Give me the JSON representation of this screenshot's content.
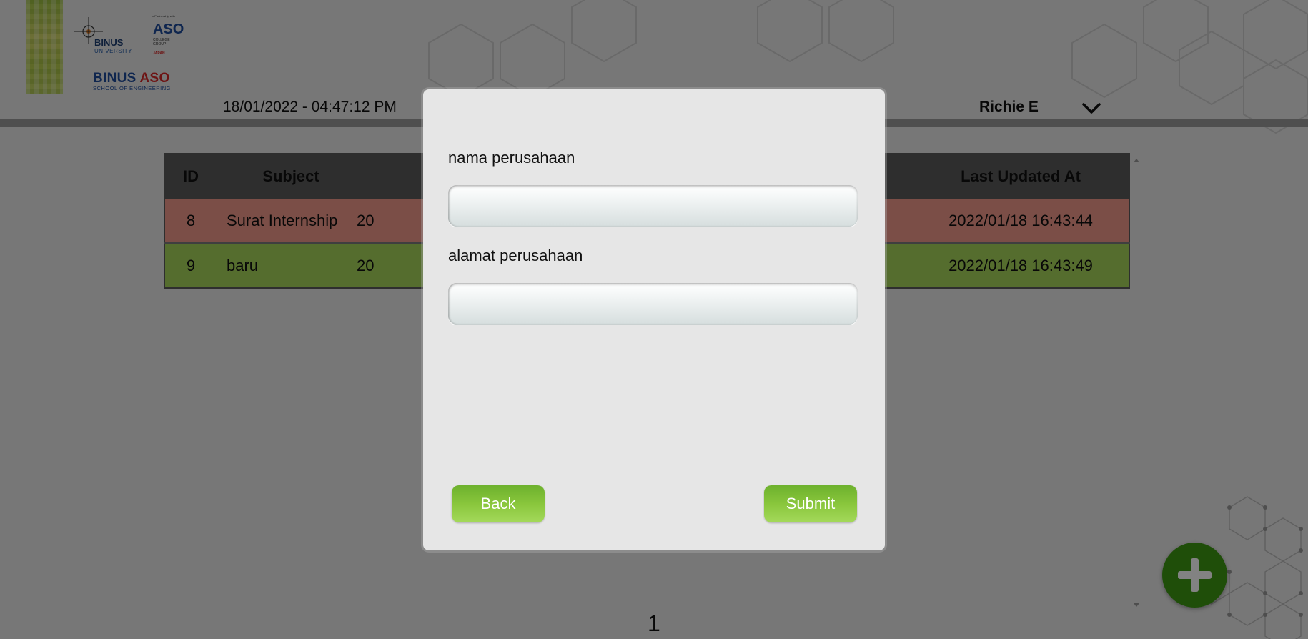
{
  "header": {
    "logos": {
      "binus": {
        "title": "BINUS",
        "subtitle": "UNIVERSITY"
      },
      "aso": {
        "tagline": "in Partnership with",
        "title": "ASO",
        "subtitle_line1": "COLLEGE",
        "subtitle_line2": "GROUP",
        "country": "JAPAN"
      },
      "binus_aso": {
        "part1": "BINUS",
        "part2": "ASO",
        "subtitle": "SCHOOL OF ENGINEERING"
      }
    },
    "datetime": "18/01/2022 - 04:47:12 PM",
    "user_name": "Richie E",
    "user_menu_icon": "chevron-down-icon"
  },
  "table": {
    "columns": [
      "ID",
      "Subject",
      "",
      "Last Updated At"
    ],
    "rows": [
      {
        "id": "8",
        "subject": "Surat Internship",
        "created": "20",
        "last_updated": "2022/01/18 16:43:44",
        "status_color": "#f29a8b"
      },
      {
        "id": "9",
        "subject": "baru",
        "created": "20",
        "last_updated": "2022/01/18 16:43:49",
        "status_color": "#a7d65b"
      }
    ]
  },
  "pagination": {
    "current_page": "1"
  },
  "fab": {
    "icon": "plus-icon"
  },
  "modal": {
    "field1_label": "nama perusahaan",
    "field1_value": "",
    "field2_label": "alamat perusahaan",
    "field2_value": "",
    "back_label": "Back",
    "submit_label": "Submit"
  },
  "colors": {
    "accent_green": "#3e9a12",
    "button_green": "#89c63c",
    "overlay": "rgba(0,0,0,0.49)"
  }
}
